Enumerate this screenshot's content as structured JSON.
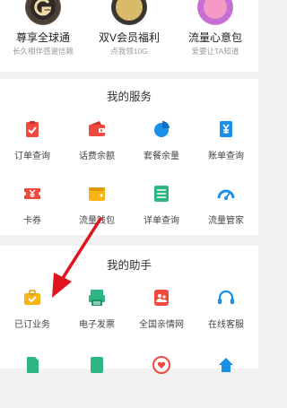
{
  "promos": [
    {
      "title": "尊享全球通",
      "subtitle": "长久相伴感谢信赖",
      "icon": "g-logo-icon"
    },
    {
      "title": "双V会员福利",
      "subtitle": "点我领10G",
      "badge": "双V会员福利",
      "icon": "vip-badge-icon"
    },
    {
      "title": "流量心意包",
      "subtitle": "爱要让TA知道",
      "icon": "gift-bubble-icon"
    }
  ],
  "services": {
    "title": "我的服务",
    "items": [
      {
        "label": "订单查询",
        "icon": "order-check-icon"
      },
      {
        "label": "话费余额",
        "icon": "wallet-icon"
      },
      {
        "label": "套餐余量",
        "icon": "pie-chart-icon"
      },
      {
        "label": "账单查询",
        "icon": "bill-yen-icon"
      },
      {
        "label": "卡券",
        "icon": "coupon-icon"
      },
      {
        "label": "流量钱包",
        "icon": "data-wallet-icon"
      },
      {
        "label": "详单查询",
        "icon": "detail-list-icon"
      },
      {
        "label": "流量管家",
        "icon": "gauge-icon"
      }
    ]
  },
  "assistant": {
    "title": "我的助手",
    "items": [
      {
        "label": "已订业务",
        "icon": "subscribed-briefcase-icon"
      },
      {
        "label": "电子发票",
        "icon": "invoice-printer-icon"
      },
      {
        "label": "全国亲情网",
        "icon": "family-network-icon"
      },
      {
        "label": "在线客服",
        "icon": "headset-icon"
      }
    ]
  },
  "colors": {
    "red": "#f04a3e",
    "orange": "#f7b515",
    "green": "#2fb783",
    "blue": "#1a8fe8",
    "arrow": "#e0141e"
  }
}
